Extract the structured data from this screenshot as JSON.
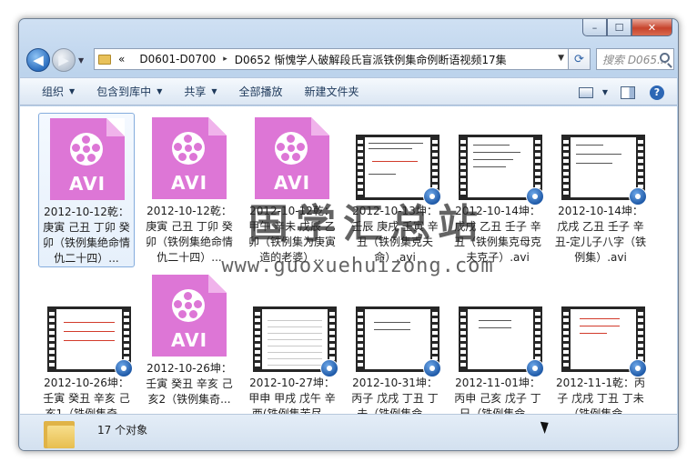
{
  "window": {
    "minimize_glyph": "–",
    "maximize_glyph": "☐",
    "close_glyph": "✕"
  },
  "address": {
    "prefix": "«",
    "crumbs": [
      "D0601-D0700",
      "D0652 惭愧学人破解段氏盲派铁例集命例断语视频17集"
    ],
    "separator": "▸"
  },
  "search": {
    "placeholder": "搜索 D065..."
  },
  "toolbar": {
    "organize": "组织",
    "include_in_library": "包含到库中",
    "share": "共享",
    "play_all": "全部播放",
    "new_folder": "新建文件夹"
  },
  "files": [
    {
      "label": "2012-10-12乾：庚寅 己丑 丁卯 癸卯（铁例集绝命情仇二十四）...",
      "thumb": "avi"
    },
    {
      "label": "2012-10-12乾：庚寅 己丑 丁卯 癸卯（铁例集绝命情仇二十四）...",
      "thumb": "avi"
    },
    {
      "label": "2012-10-12乾：甲午 辛未 戊辰 乙卯（铁例集为庚寅造的老婆）...",
      "thumb": "avi"
    },
    {
      "label": "2012-10-13坤：壬辰 庚戌 壬寅 辛丑（铁例集克夫命）.avi",
      "thumb": "video"
    },
    {
      "label": "2012-10-14坤：戊戌 乙丑 壬子 辛丑（铁例集克母克夫克子）.avi",
      "thumb": "video"
    },
    {
      "label": "2012-10-14坤：戊戌 乙丑 壬子 辛丑-定儿子八字（铁例集）.avi",
      "thumb": "video"
    },
    {
      "label": "2012-10-26坤：壬寅 癸丑 辛亥 己亥1（铁例集奇...",
      "thumb": "video-red"
    },
    {
      "label": "2012-10-26坤：壬寅 癸丑 辛亥 己亥2（铁例集奇...",
      "thumb": "avi"
    },
    {
      "label": "2012-10-27坤：甲申 甲戌 戊午 辛酉(铁例集苦尽...",
      "thumb": "video-cal"
    },
    {
      "label": "2012-10-31坤：丙子 戊戌 丁丑 丁未（铁例集命...",
      "thumb": "video"
    },
    {
      "label": "2012-11-01坤：丙申 己亥 戊子 丁巳（铁例集命...",
      "thumb": "video"
    },
    {
      "label": "2012-11-1乾：丙子 戊戌 丁丑 丁未（铁例集命...",
      "thumb": "video-red"
    }
  ],
  "avi_text": "AVI",
  "watermark": {
    "cn": "国学汇总站",
    "url": "www.guoxuehuizong.com"
  },
  "status": {
    "count": "17 个对象"
  }
}
